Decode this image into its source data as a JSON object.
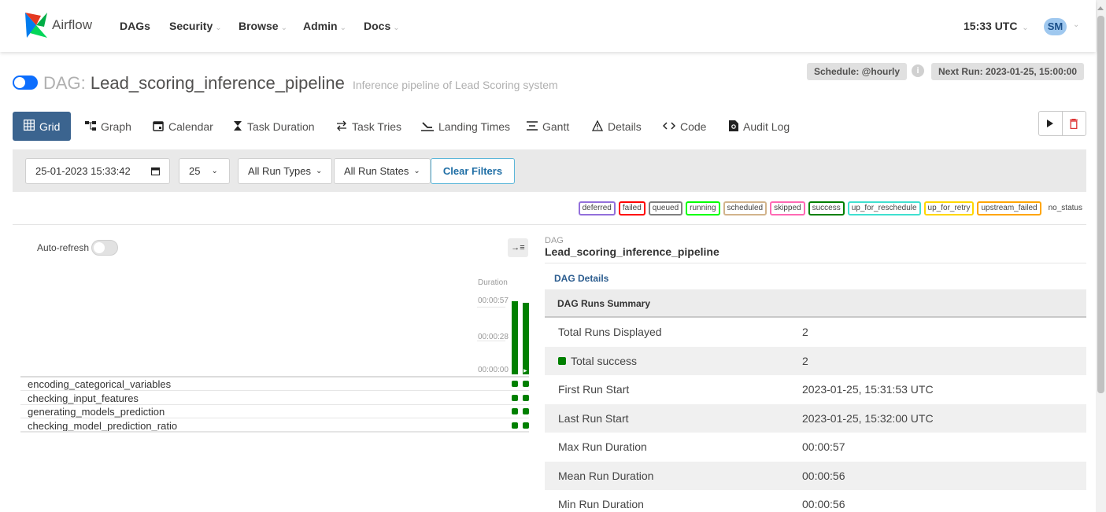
{
  "navbar": {
    "brand": "Airflow",
    "items": [
      {
        "label": "DAGs"
      },
      {
        "label": "Security"
      },
      {
        "label": "Browse"
      },
      {
        "label": "Admin"
      },
      {
        "label": "Docs"
      }
    ],
    "time": "15:33 UTC",
    "avatar": "SM"
  },
  "title": {
    "prefix": "DAG: ",
    "dag_id": "Lead_scoring_inference_pipeline",
    "description": "Inference pipeline of Lead Scoring system",
    "schedule": "Schedule: @hourly",
    "next_run": "Next Run: 2023-01-25, 15:00:00",
    "paused": false
  },
  "tabs": [
    {
      "label": "Grid",
      "icon": "grid-icon",
      "active": true
    },
    {
      "label": "Graph",
      "icon": "graph-icon"
    },
    {
      "label": "Calendar",
      "icon": "calendar-icon"
    },
    {
      "label": "Task Duration",
      "icon": "hourglass-icon"
    },
    {
      "label": "Task Tries",
      "icon": "retry-icon"
    },
    {
      "label": "Landing Times",
      "icon": "landing-icon"
    },
    {
      "label": "Gantt",
      "icon": "gantt-icon"
    },
    {
      "label": "Details",
      "icon": "warning-icon"
    },
    {
      "label": "Code",
      "icon": "code-icon"
    },
    {
      "label": "Audit Log",
      "icon": "audit-icon"
    }
  ],
  "filters": {
    "base_date": "25-01-2023 15:33:42",
    "num_runs": "25",
    "run_type": "All Run Types",
    "run_state": "All Run States",
    "clear": "Clear Filters"
  },
  "legend": [
    {
      "label": "deferred",
      "color": "#9370db"
    },
    {
      "label": "failed",
      "color": "#ff0000"
    },
    {
      "label": "queued",
      "color": "#808080"
    },
    {
      "label": "running",
      "color": "#00ff00"
    },
    {
      "label": "scheduled",
      "color": "#d2b48c"
    },
    {
      "label": "skipped",
      "color": "#ff69b4"
    },
    {
      "label": "success",
      "color": "#008000"
    },
    {
      "label": "up_for_reschedule",
      "color": "#40e0d0"
    },
    {
      "label": "up_for_retry",
      "color": "#ffd700"
    },
    {
      "label": "upstream_failed",
      "color": "#ffa500"
    },
    {
      "label": "no_status",
      "color": null
    }
  ],
  "grid": {
    "auto_refresh": "Auto-refresh",
    "duration_label": "Duration",
    "ticks": [
      "00:00:57",
      "00:00:28",
      "00:00:00"
    ],
    "run_durations_sec": [
      57,
      56
    ],
    "tasks": [
      "encoding_categorical_variables",
      "checking_input_features",
      "generating_models_prediction",
      "checking_model_prediction_ratio"
    ],
    "task_state": "success"
  },
  "details": {
    "crumb_label": "DAG",
    "crumb_name": "Lead_scoring_inference_pipeline",
    "link": "DAG Details",
    "summary_title": "DAG Runs Summary",
    "rows": [
      {
        "key": "Total Runs Displayed",
        "value": "2"
      },
      {
        "key": "Total success",
        "value": "2",
        "swatch": true
      },
      {
        "key": "First Run Start",
        "value": "2023-01-25, 15:31:53 UTC"
      },
      {
        "key": "Last Run Start",
        "value": "2023-01-25, 15:32:00 UTC"
      },
      {
        "key": "Max Run Duration",
        "value": "00:00:57"
      },
      {
        "key": "Mean Run Duration",
        "value": "00:00:56"
      },
      {
        "key": "Min Run Duration",
        "value": "00:00:56"
      }
    ]
  }
}
